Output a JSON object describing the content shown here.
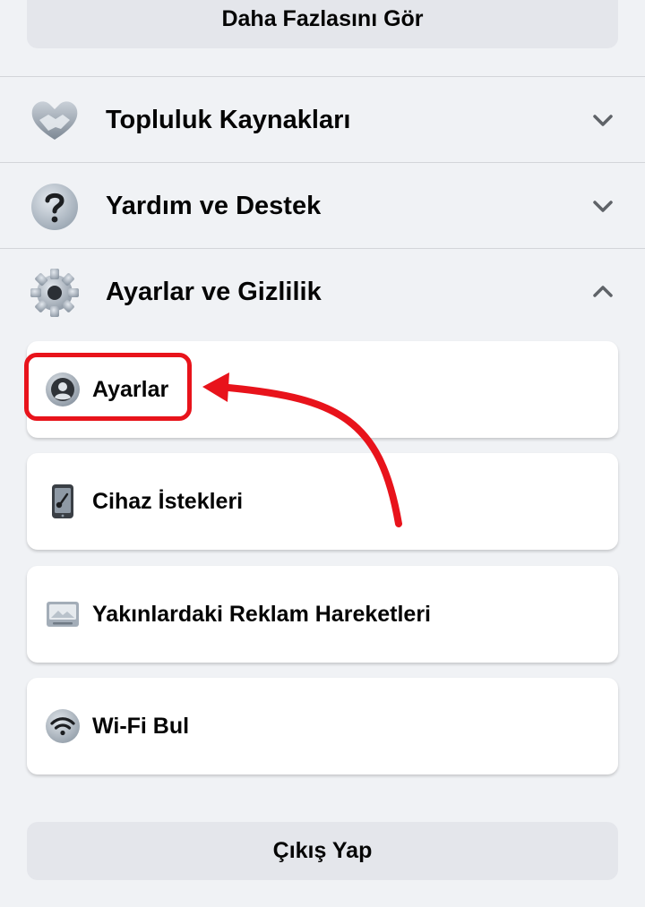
{
  "see_more": {
    "label": "Daha Fazlasını Gör"
  },
  "sections": {
    "community": {
      "label": "Topluluk Kaynakları",
      "icon": "handshake-heart-icon",
      "expanded": false
    },
    "help": {
      "label": "Yardım ve Destek",
      "icon": "question-mark-icon",
      "expanded": false
    },
    "settings": {
      "label": "Ayarlar ve Gizlilik",
      "icon": "gear-icon",
      "expanded": true
    }
  },
  "settings_items": [
    {
      "label": "Ayarlar",
      "icon": "profile-icon"
    },
    {
      "label": "Cihaz İstekleri",
      "icon": "phone-key-icon"
    },
    {
      "label": "Yakınlardaki Reklam Hareketleri",
      "icon": "ad-screen-icon"
    },
    {
      "label": "Wi-Fi Bul",
      "icon": "wifi-icon"
    }
  ],
  "logout": {
    "label": "Çıkış Yap"
  },
  "annotation": {
    "color": "#e8131b",
    "target": "Ayarlar"
  },
  "colors": {
    "background": "#f0f2f5",
    "button": "#e4e6eb",
    "card": "#ffffff",
    "text": "#050505"
  }
}
